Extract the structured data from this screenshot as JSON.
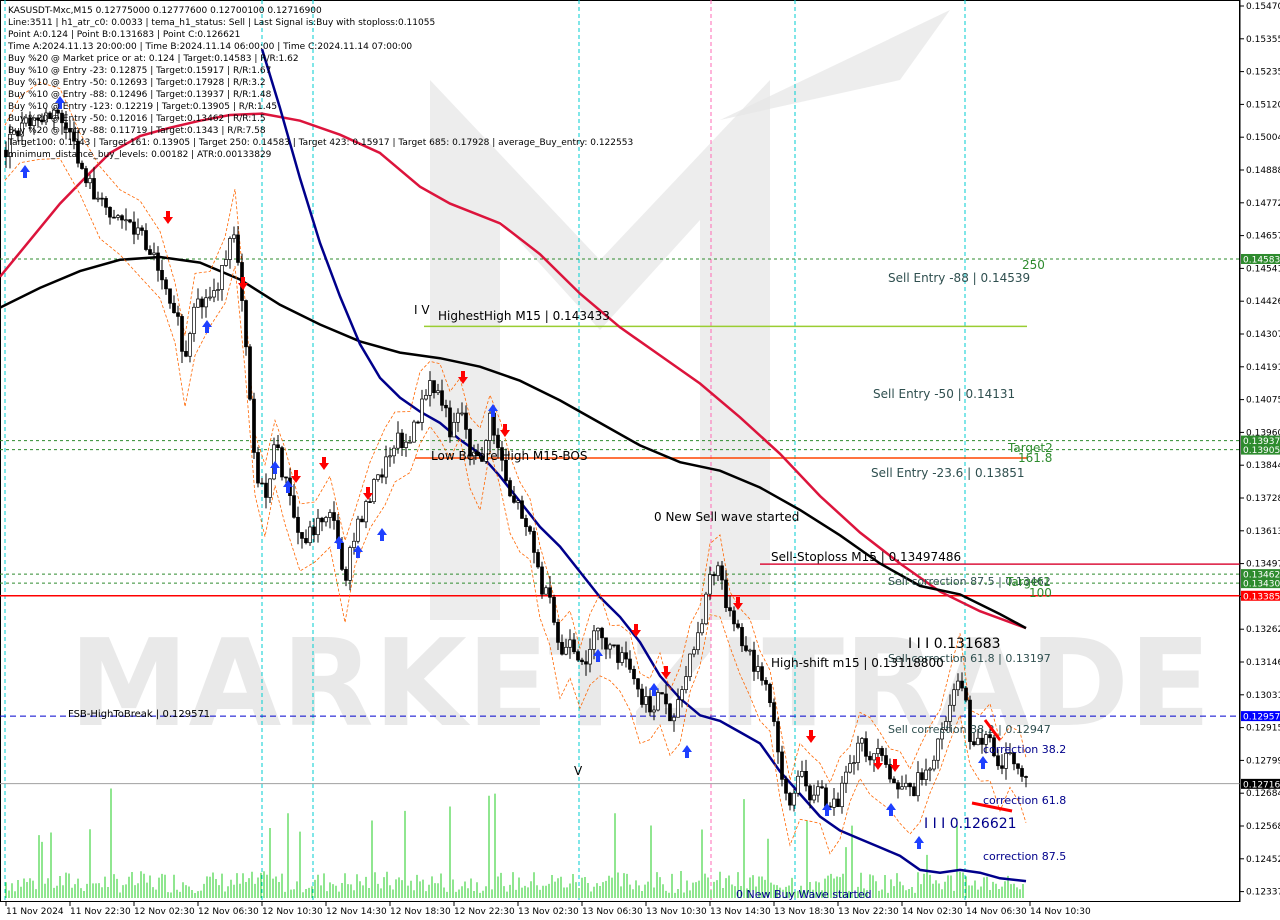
{
  "header": {
    "lines": [
      "KASUSDT-Mxc,M15  0.12775000 0.12777600 0.12700100 0.12716900",
      "Line:3511 | h1_atr_c0: 0.0033 | tema_h1_status: Sell | Last Signal is:Buy with stoploss:0.11055",
      "Point A:0.124 | Point B:0.131683 | Point C:0.126621",
      "Time A:2024.11.13 20:00:00 | Time B:2024.11.14 06:00:00 | Time C:2024.11.14 07:00:00",
      "Buy %20 @ Market price or at: 0.124 | Target:0.14583 | R/R:1.62",
      "Buy %10 @ Entry -23: 0.12875 | Target:0.15917 | R/R:1.67",
      "Buy %10 @ Entry -50: 0.12693 | Target:0.17928 | R/R:3.2",
      "Buy %10 @ Entry -88: 0.12496 | Target:0.13937 | R/R:1.48",
      "Buy %10 @ Entry -123: 0.12219 | Target:0.13905 | R/R:1.45",
      "Buy %20 @ Entry -50: 0.12016 | Target:0.13462 | R/R:1.5",
      "Buy %20 @ Entry -88: 0.11719 | Target:0.1343 | R/R:7.58",
      "Target100: 0.1343 | Target 161: 0.13905 | Target 250: 0.14583 | Target 423: 0.15917 | Target 685: 0.17928 | average_Buy_entry: 0.122553",
      "minimum_distance_buy_levels: 0.00182 | ATR:0.00133829"
    ]
  },
  "price_axis": {
    "ticks": [
      "0.15470",
      "0.15355",
      "0.15235",
      "0.15120",
      "0.15004",
      "0.14888",
      "0.14772",
      "0.14657",
      "0.14541",
      "0.14426",
      "0.14307",
      "0.14191",
      "0.14075",
      "0.13960",
      "0.13844",
      "0.13728",
      "0.13613",
      "0.13497",
      "0.13381",
      "0.13262",
      "0.13146",
      "0.13031",
      "0.12915",
      "0.12799",
      "0.12684",
      "0.12568",
      "0.12452",
      "0.12337"
    ],
    "labels": [
      {
        "text": "0.14583",
        "color": "#2e8b2e",
        "price": 0.14583
      },
      {
        "text": "0.13937",
        "color": "#2e8b2e",
        "price": 0.13937
      },
      {
        "text": "0.13905",
        "color": "#2e8b2e",
        "price": 0.13905
      },
      {
        "text": "0.13462",
        "color": "#2e8b2e",
        "price": 0.13462
      },
      {
        "text": "0.13430",
        "color": "#2e8b2e",
        "price": 0.1343
      },
      {
        "text": "0.13385",
        "color": "#ff0000",
        "price": 0.13385
      },
      {
        "text": "0.12957",
        "color": "#0000ff",
        "price": 0.12957
      },
      {
        "text": "0.12716",
        "color": "#000000",
        "price": 0.12716
      }
    ]
  },
  "time_axis": {
    "labels": [
      "11 Nov 2024",
      "11 Nov 22:30",
      "12 Nov 02:30",
      "12 Nov 06:30",
      "12 Nov 10:30",
      "12 Nov 14:30",
      "12 Nov 18:30",
      "12 Nov 22:30",
      "13 Nov 02:30",
      "13 Nov 06:30",
      "13 Nov 10:30",
      "13 Nov 14:30",
      "13 Nov 18:30",
      "13 Nov 22:30",
      "14 Nov 02:30",
      "14 Nov 06:30",
      "14 Nov 10:30"
    ]
  },
  "annotations": {
    "highest_high": "HighestHigh   M15 | 0.143433",
    "low_before_high": "Low Before High   M15-BOS",
    "sell_entry_88": "Sell Entry -88 | 0.14539",
    "sell_entry_50": "Sell Entry -50 | 0.14131",
    "sell_entry_236": "Sell Entry -23.6 | 0.13851",
    "sell_stoploss": "Sell-Stoploss M15 | 0.13497486",
    "sell_correction_875": "Sell correction 87.5 | 0.13462",
    "sell_correction_618": "Sell correction 61.8 | 0.13197",
    "sell_correction_382": "Sell correction 38.2 | 0.12947",
    "high_shift": "High-shift m15 | 0.13118800",
    "point_b": "I I I 0.131683",
    "point_c": "I I I 0.126621",
    "fsb": "FSB-HighToBreak | 0.129571",
    "new_sell_wave": "0 New Sell wave started",
    "new_buy_wave": "0 New Buy Wave started",
    "correction_382": "correction 38.2",
    "correction_618": "correction 61.8",
    "correction_875": "correction 87.5",
    "target_250": "250",
    "target2": "Target2",
    "fib_1618": "161.8",
    "target1": "Target1",
    "fib_100": "100",
    "wave_iv": "I V",
    "wave_v": "V",
    "watermark": "MARKETZITRADE"
  },
  "chart_data": {
    "type": "candlestick",
    "symbol": "KASUSDT-Mxc",
    "timeframe": "M15",
    "ylim": [
      0.1231,
      0.1549
    ],
    "ohlc_last": {
      "open": 0.12775,
      "high": 0.127776,
      "low": 0.127001,
      "close": 0.127169
    },
    "levels": [
      {
        "name": "HighestHigh M15",
        "price": 0.143433,
        "color": "#9acd32"
      },
      {
        "name": "Low Before High M15-BOS",
        "price": 0.13875,
        "color": "#ff4500"
      },
      {
        "name": "Sell-Stoploss M15",
        "price": 0.13497486,
        "color": "#dc143c"
      },
      {
        "name": "Level 0.13385",
        "price": 0.13385,
        "color": "#ff0000"
      },
      {
        "name": "FSB-HighToBreak",
        "price": 0.129571,
        "color": "#0000cd"
      },
      {
        "name": "Target 250",
        "price": 0.14583,
        "color": "#2e8b2e"
      },
      {
        "name": "Target2",
        "price": 0.13937,
        "color": "#2e8b2e"
      },
      {
        "name": "Target 161.8",
        "price": 0.13905,
        "color": "#2e8b2e"
      },
      {
        "name": "Target1",
        "price": 0.13462,
        "color": "#2e8b2e"
      },
      {
        "name": "Target 100",
        "price": 0.1343,
        "color": "#2e8b2e"
      }
    ],
    "moving_averages": [
      {
        "name": "MA crimson",
        "color": "#dc143c",
        "points": [
          [
            0,
            0.1452
          ],
          [
            30,
            0.1465
          ],
          [
            60,
            0.1478
          ],
          [
            90,
            0.1489
          ],
          [
            110,
            0.1496
          ],
          [
            140,
            0.1502
          ],
          [
            170,
            0.1505
          ],
          [
            200,
            0.15075
          ],
          [
            230,
            0.15095
          ],
          [
            262,
            0.151
          ],
          [
            300,
            0.15075
          ],
          [
            340,
            0.15025
          ],
          [
            380,
            0.1496
          ],
          [
            420,
            0.1484
          ],
          [
            450,
            0.1478
          ],
          [
            500,
            0.1471
          ],
          [
            540,
            0.146
          ],
          [
            580,
            0.1446
          ],
          [
            620,
            0.1434
          ],
          [
            660,
            0.1424
          ],
          [
            700,
            0.1414
          ],
          [
            740,
            0.1402
          ],
          [
            780,
            0.1389
          ],
          [
            820,
            0.1374
          ],
          [
            860,
            0.1361
          ],
          [
            900,
            0.135
          ],
          [
            940,
            0.134
          ],
          [
            980,
            0.1333
          ],
          [
            1026,
            0.1327
          ]
        ]
      },
      {
        "name": "MA black",
        "color": "#000000",
        "points": [
          [
            0,
            0.1441
          ],
          [
            40,
            0.1448
          ],
          [
            80,
            0.1454
          ],
          [
            120,
            0.1458
          ],
          [
            160,
            0.1459
          ],
          [
            200,
            0.1457
          ],
          [
            240,
            0.1451
          ],
          [
            280,
            0.1442
          ],
          [
            320,
            0.1435
          ],
          [
            360,
            0.1429
          ],
          [
            400,
            0.1425
          ],
          [
            440,
            0.1423
          ],
          [
            480,
            0.142
          ],
          [
            520,
            0.1415
          ],
          [
            560,
            0.1408
          ],
          [
            600,
            0.14
          ],
          [
            640,
            0.1392
          ],
          [
            680,
            0.1386
          ],
          [
            720,
            0.1383
          ],
          [
            760,
            0.1377
          ],
          [
            800,
            0.1369
          ],
          [
            840,
            0.136
          ],
          [
            880,
            0.135
          ],
          [
            920,
            0.1342
          ],
          [
            960,
            0.1339
          ],
          [
            1000,
            0.1332
          ],
          [
            1026,
            0.1327
          ]
        ]
      },
      {
        "name": "MA navy",
        "color": "#00008b",
        "points": [
          [
            262,
            0.1533
          ],
          [
            280,
            0.1512
          ],
          [
            300,
            0.1487
          ],
          [
            320,
            0.1464
          ],
          [
            340,
            0.1445
          ],
          [
            360,
            0.1428
          ],
          [
            380,
            0.1416
          ],
          [
            400,
            0.1409
          ],
          [
            420,
            0.1404
          ],
          [
            440,
            0.14
          ],
          [
            460,
            0.1394
          ],
          [
            480,
            0.1389
          ],
          [
            500,
            0.1381
          ],
          [
            520,
            0.1372
          ],
          [
            540,
            0.1363
          ],
          [
            560,
            0.1356
          ],
          [
            580,
            0.1347
          ],
          [
            600,
            0.1338
          ],
          [
            620,
            0.1331
          ],
          [
            640,
            0.1322
          ],
          [
            660,
            0.131
          ],
          [
            680,
            0.1302
          ],
          [
            700,
            0.1296
          ],
          [
            720,
            0.1294
          ],
          [
            740,
            0.129
          ],
          [
            760,
            0.1286
          ],
          [
            780,
            0.1276
          ],
          [
            800,
            0.1268
          ],
          [
            820,
            0.126
          ],
          [
            840,
            0.1255
          ],
          [
            860,
            0.1252
          ],
          [
            880,
            0.1249
          ],
          [
            900,
            0.1246
          ],
          [
            920,
            0.1241
          ],
          [
            940,
            0.124
          ],
          [
            960,
            0.1241
          ],
          [
            980,
            0.124
          ],
          [
            1000,
            0.1238
          ],
          [
            1026,
            0.1237
          ]
        ]
      }
    ],
    "price_path": [
      [
        5,
        0.1497
      ],
      [
        20,
        0.1505
      ],
      [
        40,
        0.1508
      ],
      [
        60,
        0.151
      ],
      [
        80,
        0.1492
      ],
      [
        100,
        0.1478
      ],
      [
        120,
        0.1474
      ],
      [
        140,
        0.1468
      ],
      [
        160,
        0.1455
      ],
      [
        175,
        0.1441
      ],
      [
        185,
        0.142
      ],
      [
        195,
        0.144
      ],
      [
        210,
        0.1445
      ],
      [
        225,
        0.1455
      ],
      [
        235,
        0.147
      ],
      [
        245,
        0.1435
      ],
      [
        255,
        0.1385
      ],
      [
        265,
        0.1372
      ],
      [
        275,
        0.1392
      ],
      [
        285,
        0.138
      ],
      [
        300,
        0.1358
      ],
      [
        315,
        0.1363
      ],
      [
        330,
        0.137
      ],
      [
        345,
        0.1345
      ],
      [
        355,
        0.136
      ],
      [
        370,
        0.1375
      ],
      [
        385,
        0.1385
      ],
      [
        395,
        0.1395
      ],
      [
        410,
        0.1393
      ],
      [
        420,
        0.1405
      ],
      [
        430,
        0.1413
      ],
      [
        440,
        0.141
      ],
      [
        450,
        0.1398
      ],
      [
        460,
        0.1407
      ],
      [
        470,
        0.1391
      ],
      [
        480,
        0.1385
      ],
      [
        490,
        0.1401
      ],
      [
        500,
        0.139
      ],
      [
        510,
        0.1375
      ],
      [
        520,
        0.137
      ],
      [
        530,
        0.1362
      ],
      [
        540,
        0.1343
      ],
      [
        550,
        0.1335
      ],
      [
        560,
        0.1318
      ],
      [
        570,
        0.132
      ],
      [
        580,
        0.1311
      ],
      [
        590,
        0.1321
      ],
      [
        600,
        0.1326
      ],
      [
        610,
        0.1319
      ],
      [
        620,
        0.1317
      ],
      [
        630,
        0.1312
      ],
      [
        640,
        0.1302
      ],
      [
        650,
        0.1298
      ],
      [
        660,
        0.1305
      ],
      [
        670,
        0.1296
      ],
      [
        680,
        0.1302
      ],
      [
        690,
        0.1315
      ],
      [
        700,
        0.1326
      ],
      [
        710,
        0.1346
      ],
      [
        720,
        0.1347
      ],
      [
        730,
        0.1331
      ],
      [
        740,
        0.1323
      ],
      [
        750,
        0.1317
      ],
      [
        760,
        0.131
      ],
      [
        770,
        0.1301
      ],
      [
        780,
        0.1279
      ],
      [
        790,
        0.1264
      ],
      [
        800,
        0.1275
      ],
      [
        810,
        0.1269
      ],
      [
        820,
        0.127
      ],
      [
        830,
        0.1261
      ],
      [
        840,
        0.1268
      ],
      [
        850,
        0.1276
      ],
      [
        860,
        0.1286
      ],
      [
        870,
        0.1282
      ],
      [
        880,
        0.1281
      ],
      [
        890,
        0.1273
      ],
      [
        900,
        0.127
      ],
      [
        910,
        0.1268
      ],
      [
        920,
        0.1274
      ],
      [
        930,
        0.1279
      ],
      [
        940,
        0.1289
      ],
      [
        950,
        0.1301
      ],
      [
        960,
        0.1312
      ],
      [
        970,
        0.1289
      ],
      [
        980,
        0.1285
      ],
      [
        990,
        0.1287
      ],
      [
        1000,
        0.1278
      ],
      [
        1010,
        0.1281
      ],
      [
        1020,
        0.1277
      ],
      [
        1026,
        0.1272
      ]
    ]
  }
}
